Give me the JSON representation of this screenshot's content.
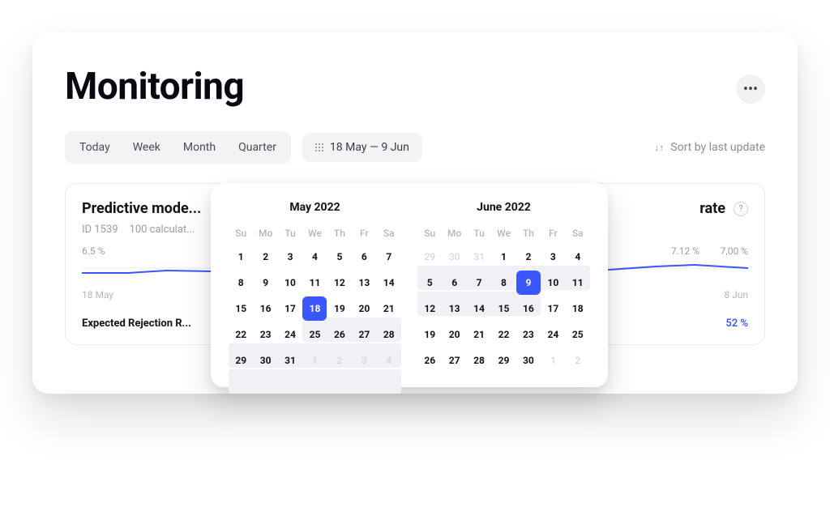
{
  "header": {
    "title": "Monitoring"
  },
  "range_tabs": [
    "Today",
    "Week",
    "Month",
    "Quarter"
  ],
  "date_chip": {
    "label": "18 May — 9 Jun"
  },
  "sort": {
    "label": "Sort by last update"
  },
  "card_left": {
    "title": "Predictive mode...",
    "id_label": "ID 1539",
    "sub2": "100 calculat...",
    "value_left": "6.5 %",
    "axis_left": "18 May",
    "foot": "Expected Rejection R..."
  },
  "card_right": {
    "title_tail": "rate",
    "value_r1": "7.12 %",
    "value_r2": "7,00 %",
    "axis_right": "8 Jun",
    "foot_r": "52 %"
  },
  "calendar": {
    "dow": [
      "Su",
      "Mo",
      "Tu",
      "We",
      "Th",
      "Fr",
      "Sa"
    ],
    "months": [
      {
        "title": "May 2022",
        "selected_day": 18,
        "leading_blank": 0,
        "prev_tail": [],
        "days": [
          1,
          2,
          3,
          4,
          5,
          6,
          7,
          8,
          9,
          10,
          11,
          12,
          13,
          14,
          15,
          16,
          17,
          18,
          19,
          20,
          21,
          22,
          23,
          24,
          25,
          26,
          27,
          28,
          29,
          30,
          31
        ],
        "next_head": [
          1,
          2,
          3,
          4
        ],
        "range_bands": [
          {
            "row": 3,
            "col_start": 3,
            "col_span": 4
          },
          {
            "row": 4,
            "col_start": 0,
            "col_span": 7
          },
          {
            "row": 5,
            "col_start": 0,
            "col_span": 7
          }
        ]
      },
      {
        "title": "June 2022",
        "selected_day": 9,
        "leading_blank": 0,
        "prev_tail": [
          29,
          30,
          31
        ],
        "days": [
          1,
          2,
          3,
          4,
          5,
          6,
          7,
          8,
          9,
          10,
          11,
          12,
          13,
          14,
          15,
          16,
          17,
          18,
          19,
          20,
          21,
          22,
          23,
          24,
          25,
          26,
          27,
          28,
          29,
          30
        ],
        "next_head": [
          1,
          2
        ],
        "range_bands": [
          {
            "row": 1,
            "col_start": 0,
            "col_span": 7
          },
          {
            "row": 2,
            "col_start": 0,
            "col_span": 5
          }
        ]
      }
    ]
  },
  "chart_data": [
    {
      "type": "line",
      "title": "Expected Rejection Rate",
      "x_start_label": "18 May",
      "ylabel": "%",
      "series": [
        {
          "name": "rate",
          "values": [
            6.5,
            6.5,
            6.6,
            6.6,
            6.7,
            6.6,
            6.7
          ]
        }
      ]
    },
    {
      "type": "line",
      "x_end_label": "8 Jun",
      "ylabel": "%",
      "series": [
        {
          "name": "rate",
          "values": [
            6.9,
            6.95,
            7.0,
            7.05,
            7.1,
            7.12,
            7.0
          ]
        }
      ]
    }
  ],
  "colors": {
    "accent": "#3a56ff",
    "muted": "#9a9aa8"
  }
}
